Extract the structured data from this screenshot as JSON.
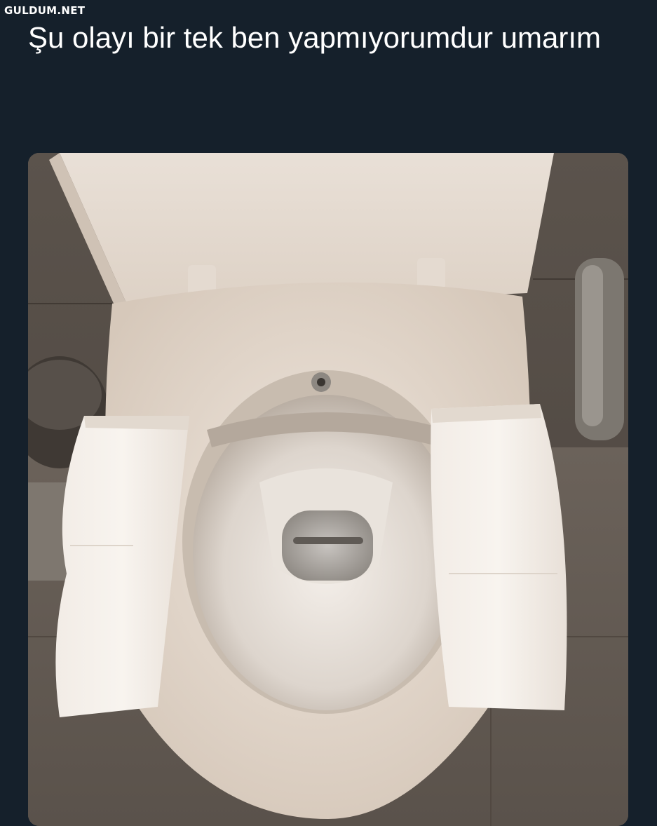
{
  "watermark": "GULDUM.NET",
  "tweet": {
    "text": "Şu olayı bir tek ben yapmıyorumdur umarım"
  },
  "media": {
    "subject": "toilet-seat-with-paper-photo"
  },
  "colors": {
    "background": "#15202b",
    "text": "#ffffff"
  }
}
